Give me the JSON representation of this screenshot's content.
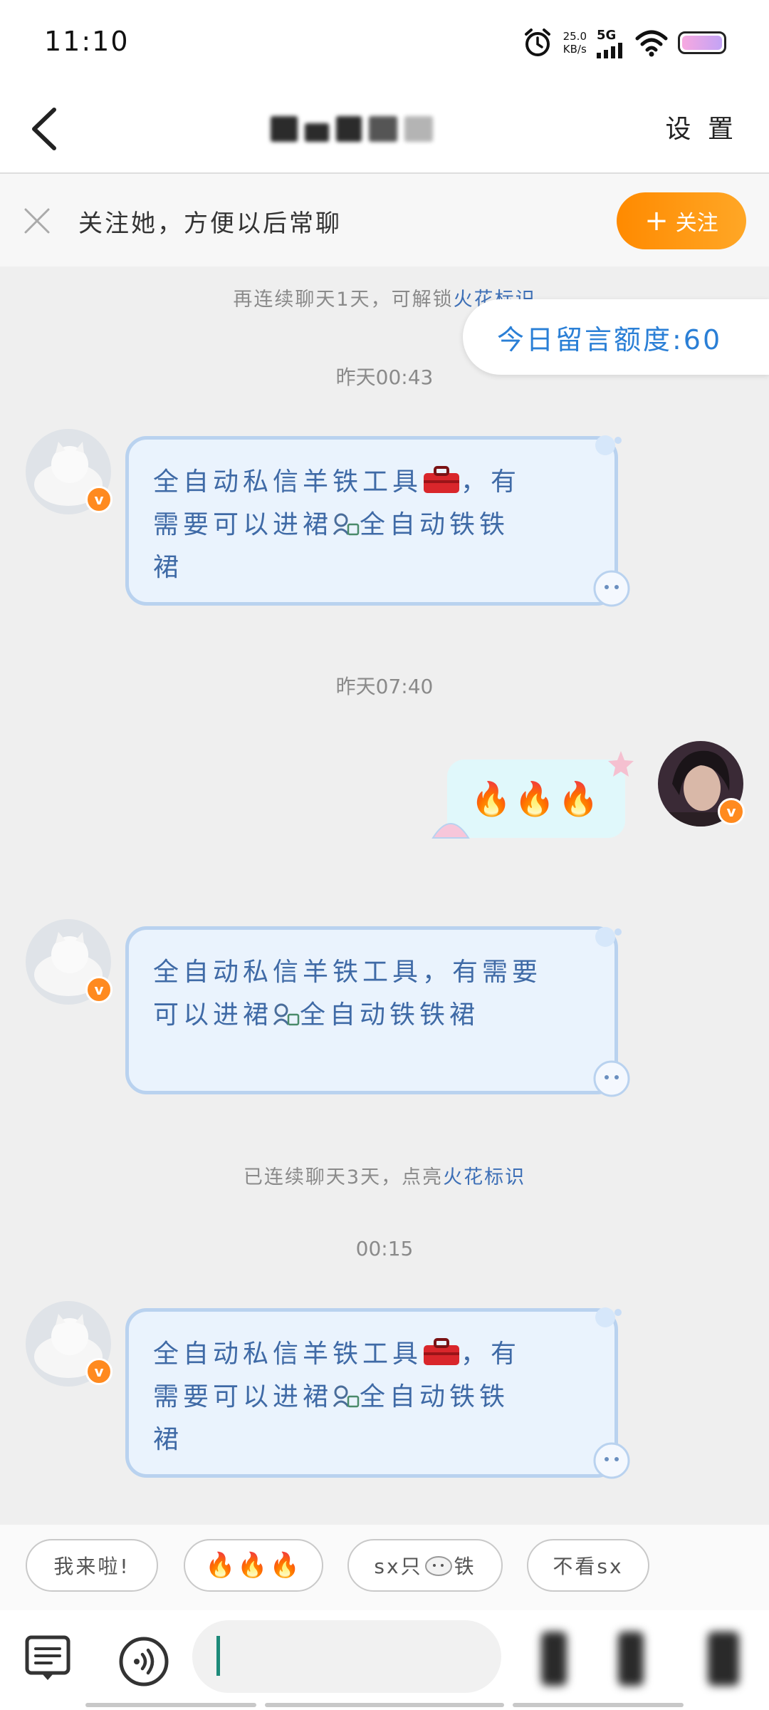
{
  "status_bar": {
    "time": "11:10",
    "net_speed": "25.0",
    "net_speed_unit": "KB/s",
    "network": "5G"
  },
  "header": {
    "settings_label": "设 置"
  },
  "follow_bar": {
    "text": "关注她，方便以后常聊",
    "button_label": "关注",
    "button_color": "#ff8a00"
  },
  "chat": {
    "streak_note_1_prefix": "再连续聊天1天，可解锁",
    "streak_note_1_highlight": "火花标识",
    "quota": "今日留言额度:60",
    "messages": [
      {
        "timestamp": "昨天00:43",
        "line1": "全自动私信羊铁工具",
        "line1_tail": "，有",
        "line2": "需要可以进裙",
        "line2_tail": "全自动铁铁",
        "line3": "裙"
      },
      {
        "timestamp": "昨天07:40",
        "sent_text": "🔥🔥🔥"
      },
      {
        "line1": "全自动私信羊铁工具，有需要",
        "line2": "可以进裙",
        "line2_tail": "全自动铁铁裙"
      }
    ],
    "streak_note_2_prefix": "已连续聊天3天，点亮",
    "streak_note_2_highlight": "火花标识",
    "timestamp_3": "00:15",
    "message_3": {
      "line1": "全自动私信羊铁工具",
      "line1_tail": "，有",
      "line2": "需要可以进裙",
      "line2_tail": "全自动铁铁",
      "line3": "裙"
    }
  },
  "quick_replies": [
    "我来啦!",
    "🔥🔥🔥",
    "sx只",
    "铁",
    "不看sx"
  ],
  "input": {
    "placeholder": ""
  }
}
